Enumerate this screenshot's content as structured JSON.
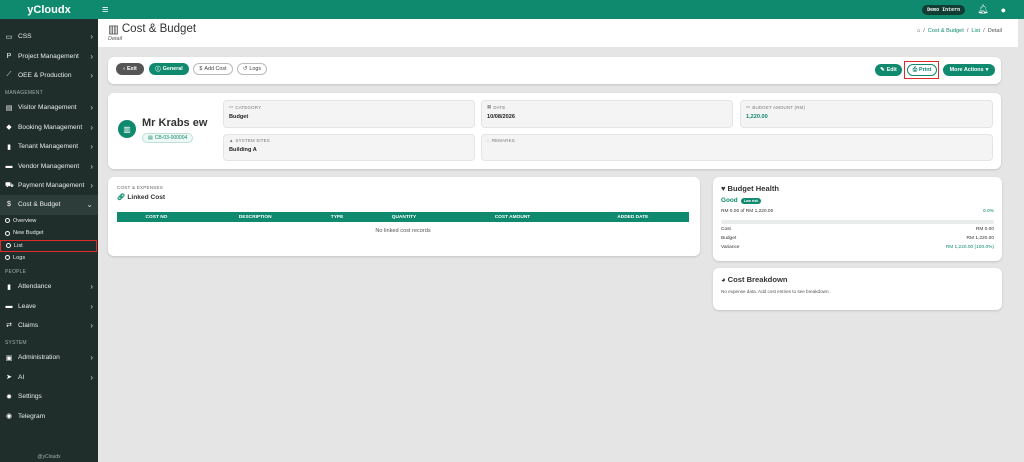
{
  "app": {
    "name": "yCloudx",
    "footer": "@yCloudx"
  },
  "sidebar": {
    "top": [
      {
        "label": "CSS",
        "icon": "monitor-icon",
        "glyph": "▭"
      },
      {
        "label": "Project Management",
        "icon": "project-icon",
        "glyph": "P"
      },
      {
        "label": "OEE & Production",
        "icon": "chart-icon",
        "glyph": "⟋"
      }
    ],
    "management_label": "MANAGEMENT",
    "management": [
      {
        "label": "Visitor Management",
        "icon": "visitor-icon",
        "glyph": "▤"
      },
      {
        "label": "Booking Management",
        "icon": "booking-icon",
        "glyph": "◆"
      },
      {
        "label": "Tenant Management",
        "icon": "tenant-icon",
        "glyph": "▮"
      },
      {
        "label": "Vendor Management",
        "icon": "vendor-icon",
        "glyph": "▬"
      },
      {
        "label": "Payment Management",
        "icon": "cart-icon",
        "glyph": "⛟"
      },
      {
        "label": "Cost & Budget",
        "icon": "dollar-icon",
        "glyph": "$"
      }
    ],
    "cost_budget_sub": [
      "Overview",
      "New Budget",
      "List",
      "Logs"
    ],
    "people_label": "PEOPLE",
    "people": [
      {
        "label": "Attendance",
        "icon": "attendance-icon",
        "glyph": "▮"
      },
      {
        "label": "Leave",
        "icon": "leave-icon",
        "glyph": "▬"
      },
      {
        "label": "Claims",
        "icon": "claims-icon",
        "glyph": "⇄"
      }
    ],
    "system_label": "SYSTEM",
    "system": [
      {
        "label": "Administration",
        "icon": "admin-icon",
        "glyph": "▣"
      },
      {
        "label": "AI",
        "icon": "ai-icon",
        "glyph": "➤"
      },
      {
        "label": "Settings",
        "icon": "gear-icon",
        "glyph": "✹"
      },
      {
        "label": "Telegram",
        "icon": "telegram-icon",
        "glyph": "◉"
      }
    ]
  },
  "topbar": {
    "tenant": "Demo Intern"
  },
  "header": {
    "title": "Cost & Budget",
    "subtitle": "Detail",
    "breadcrumb": [
      "Cost & Budget",
      "List",
      "Detail"
    ]
  },
  "actions": {
    "exit": "Exit",
    "general": "General",
    "add_cost": "Add Cost",
    "logs": "Logs",
    "edit": "Edit",
    "print": "Print",
    "more": "More Actions"
  },
  "profile": {
    "name": "Mr Krabs ew",
    "code": "CB-03-000004"
  },
  "fields": {
    "category_label": "CATEGORY",
    "category": "Budget",
    "date_label": "DATE",
    "date": "10/08/2026",
    "amount_label": "BUDGET AMOUNT (RM)",
    "amount": "1,220.00",
    "sites_label": "SYSTEM SITES",
    "sites": "Building A",
    "remarks_label": "REMARKS",
    "remarks": ""
  },
  "costs": {
    "section_label": "COST & EXPENSES",
    "title": "Linked Cost",
    "columns": [
      "COST NO",
      "DESCRIPTION",
      "TYPE",
      "QUANTITY",
      "COST AMOUNT",
      "ADDED DATE"
    ],
    "empty": "No linked cost records"
  },
  "health": {
    "title": "Budget Health",
    "status": "Good",
    "risk": "Low risk",
    "usage_text": "RM 0.00 of RM 1,220.00",
    "usage_pct": "0.0%",
    "usage_fraction": 0.0,
    "cost_label": "Cost",
    "cost": "RM 0.00",
    "budget_label": "Budget",
    "budget": "RM 1,220.00",
    "variance_label": "Variance",
    "variance": "RM 1,220.00 (100.0%)"
  },
  "breakdown": {
    "title": "Cost Breakdown",
    "empty": "No expense data. Add cost entries to see breakdown."
  },
  "colors": {
    "primary": "#0f8a6e",
    "sidebar": "#1f2d2b",
    "highlight": "#e02b2b"
  }
}
